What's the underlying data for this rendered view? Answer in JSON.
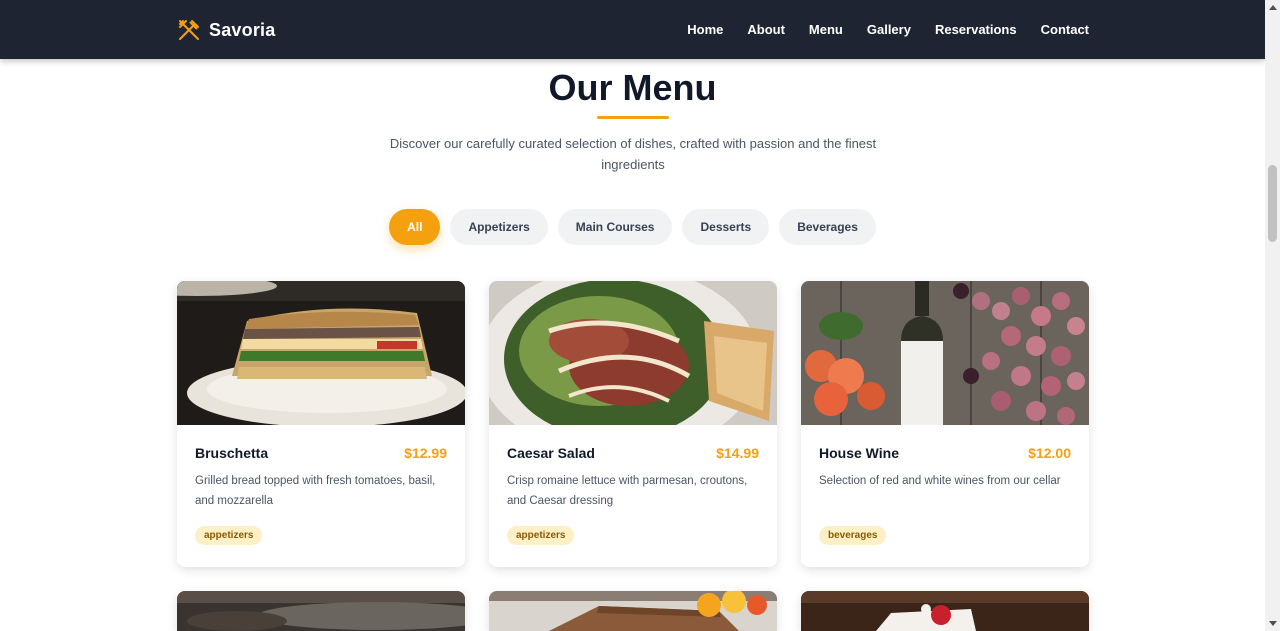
{
  "brand": {
    "name": "Savoria",
    "icon": "utensils-icon",
    "accent": "#f5a00f"
  },
  "nav": {
    "links": [
      "Home",
      "About",
      "Menu",
      "Gallery",
      "Reservations",
      "Contact"
    ]
  },
  "menu": {
    "title": "Our Menu",
    "subtitle": "Discover our carefully curated selection of dishes, crafted with passion and the finest ingredients",
    "filters": [
      {
        "label": "All",
        "active": true
      },
      {
        "label": "Appetizers",
        "active": false
      },
      {
        "label": "Main Courses",
        "active": false
      },
      {
        "label": "Desserts",
        "active": false
      },
      {
        "label": "Beverages",
        "active": false
      }
    ],
    "items": [
      {
        "name": "Bruschetta",
        "price": "$12.99",
        "description": "Grilled bread topped with fresh tomatoes, basil, and mozzarella",
        "tag": "appetizers",
        "image": "sandwich-photo"
      },
      {
        "name": "Caesar Salad",
        "price": "$14.99",
        "description": "Crisp romaine lettuce with parmesan, croutons, and Caesar dressing",
        "tag": "appetizers",
        "image": "salad-photo"
      },
      {
        "name": "House Wine",
        "price": "$12.00",
        "description": "Selection of red and white wines from our cellar",
        "tag": "beverages",
        "image": "wine-grapes-photo"
      }
    ],
    "partial_images": [
      "dark-dish-photo",
      "tiramisu-photo",
      "strawberry-cake-photo"
    ]
  },
  "colors": {
    "navbar": "#1f2433",
    "accent": "#f5a00f",
    "tag_bg": "#fdf0c7"
  }
}
